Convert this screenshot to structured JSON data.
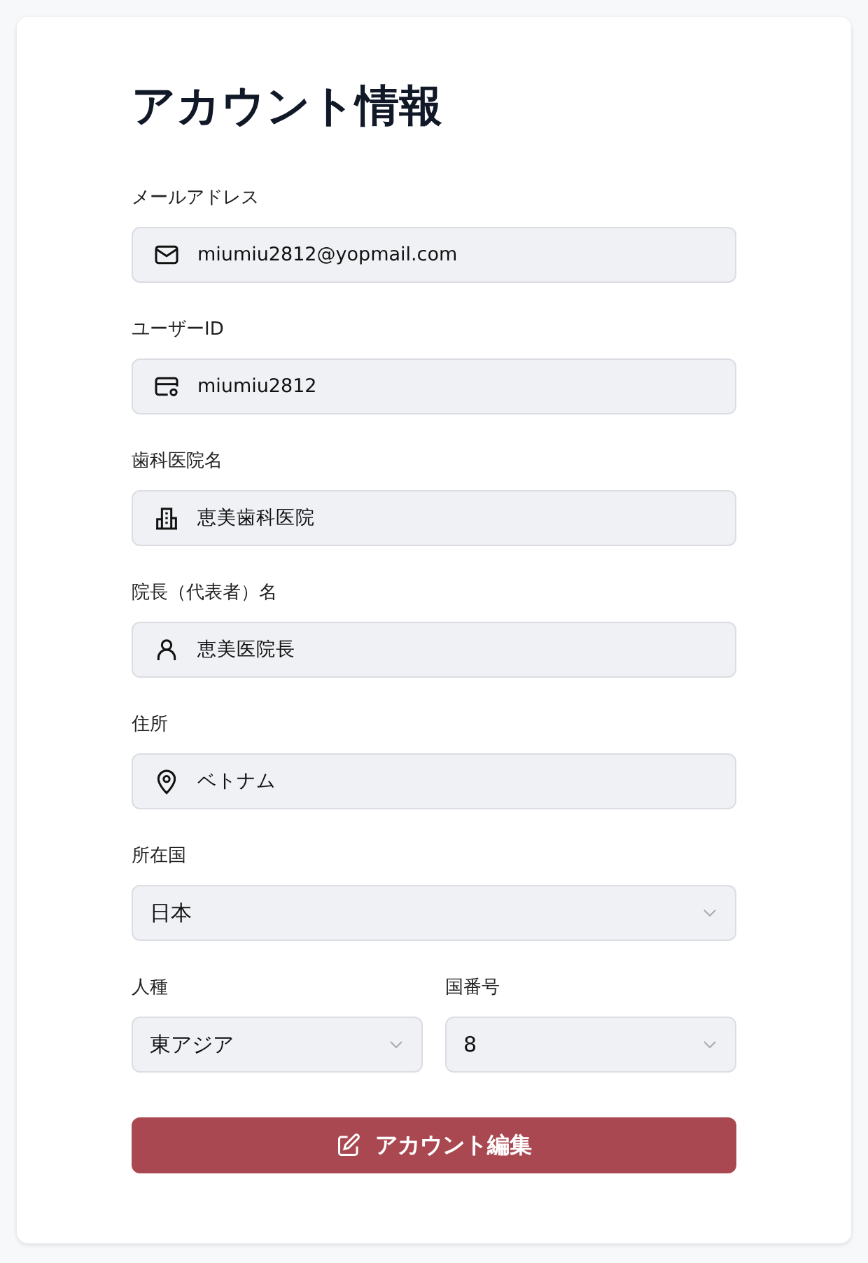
{
  "title": "アカウント情報",
  "fields": [
    {
      "kind": "input",
      "label": "メールアドレス",
      "value": "miumiu2812@yopmail.com"
    },
    {
      "kind": "input",
      "label": "ユーザーID",
      "value": "miumiu2812"
    },
    {
      "kind": "input",
      "label": "歯科医院名",
      "value": "恵美歯科医院"
    },
    {
      "kind": "input",
      "label": "院長（代表者）名",
      "value": "恵美医院長"
    },
    {
      "kind": "input",
      "label": "住所",
      "value": "ベトナム"
    },
    {
      "kind": "select",
      "label": "所在国",
      "value": "日本"
    }
  ],
  "pair": [
    {
      "kind": "select",
      "label": "人種",
      "value": "東アジア"
    },
    {
      "kind": "select",
      "label": "国番号",
      "value": "8"
    }
  ],
  "button": {
    "label": "アカウント編集"
  }
}
